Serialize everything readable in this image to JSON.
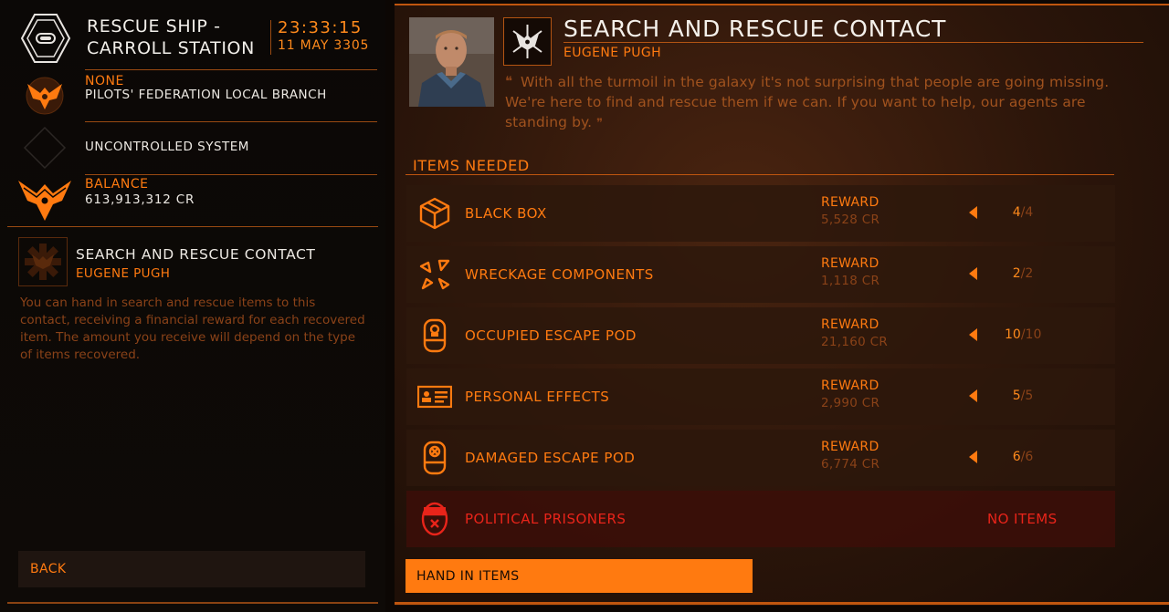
{
  "station": {
    "name": "RESCUE SHIP - CARROLL STATION",
    "name_line1": "RESCUE SHIP -",
    "name_line2": "CARROLL STATION",
    "time": "23:33:15",
    "date": "11 MAY 3305"
  },
  "faction": {
    "allegiance": "NONE",
    "name": "PILOTS' FEDERATION LOCAL BRANCH"
  },
  "system": {
    "label": "UNCONTROLLED SYSTEM"
  },
  "balance": {
    "label": "BALANCE",
    "value": "613,913,312 CR"
  },
  "contact": {
    "title": "SEARCH AND RESCUE CONTACT",
    "name": "EUGENE PUGH",
    "description": "You can hand in search and rescue items to this contact, receiving a financial reward for each recovered item. The amount you receive will depend on the type of items recovered."
  },
  "back_label": "BACK",
  "main": {
    "title": "SEARCH AND RESCUE CONTACT",
    "subtitle": "EUGENE PUGH",
    "quote": "With all the turmoil in the galaxy it's not surprising that people are going missing. We're here to find and rescue them if we can. If you want to help, our agents are standing by.",
    "items_header": "ITEMS NEEDED"
  },
  "items": [
    {
      "name": "BLACK BOX",
      "icon": "black-box-icon",
      "reward_label": "REWARD",
      "reward": "5,528 CR",
      "current": "4",
      "total": "4"
    },
    {
      "name": "WRECKAGE COMPONENTS",
      "icon": "wreckage-icon",
      "reward_label": "REWARD",
      "reward": "1,118 CR",
      "current": "2",
      "total": "2"
    },
    {
      "name": "OCCUPIED ESCAPE POD",
      "icon": "escape-pod-icon",
      "reward_label": "REWARD",
      "reward": "21,160 CR",
      "current": "10",
      "total": "10"
    },
    {
      "name": "PERSONAL EFFECTS",
      "icon": "id-card-icon",
      "reward_label": "REWARD",
      "reward": "2,990 CR",
      "current": "5",
      "total": "5"
    },
    {
      "name": "DAMAGED ESCAPE POD",
      "icon": "damaged-pod-icon",
      "reward_label": "REWARD",
      "reward": "6,774 CR",
      "current": "6",
      "total": "6"
    }
  ],
  "restricted_item": {
    "name": "POLITICAL PRISONERS",
    "icon": "prisoner-pod-icon",
    "status": "NO ITEMS"
  },
  "handin_label": "HAND IN ITEMS",
  "colors": {
    "accent": "#ff7a10",
    "dim": "#8a4218",
    "danger": "#e8241a",
    "background": "#0c0704"
  }
}
